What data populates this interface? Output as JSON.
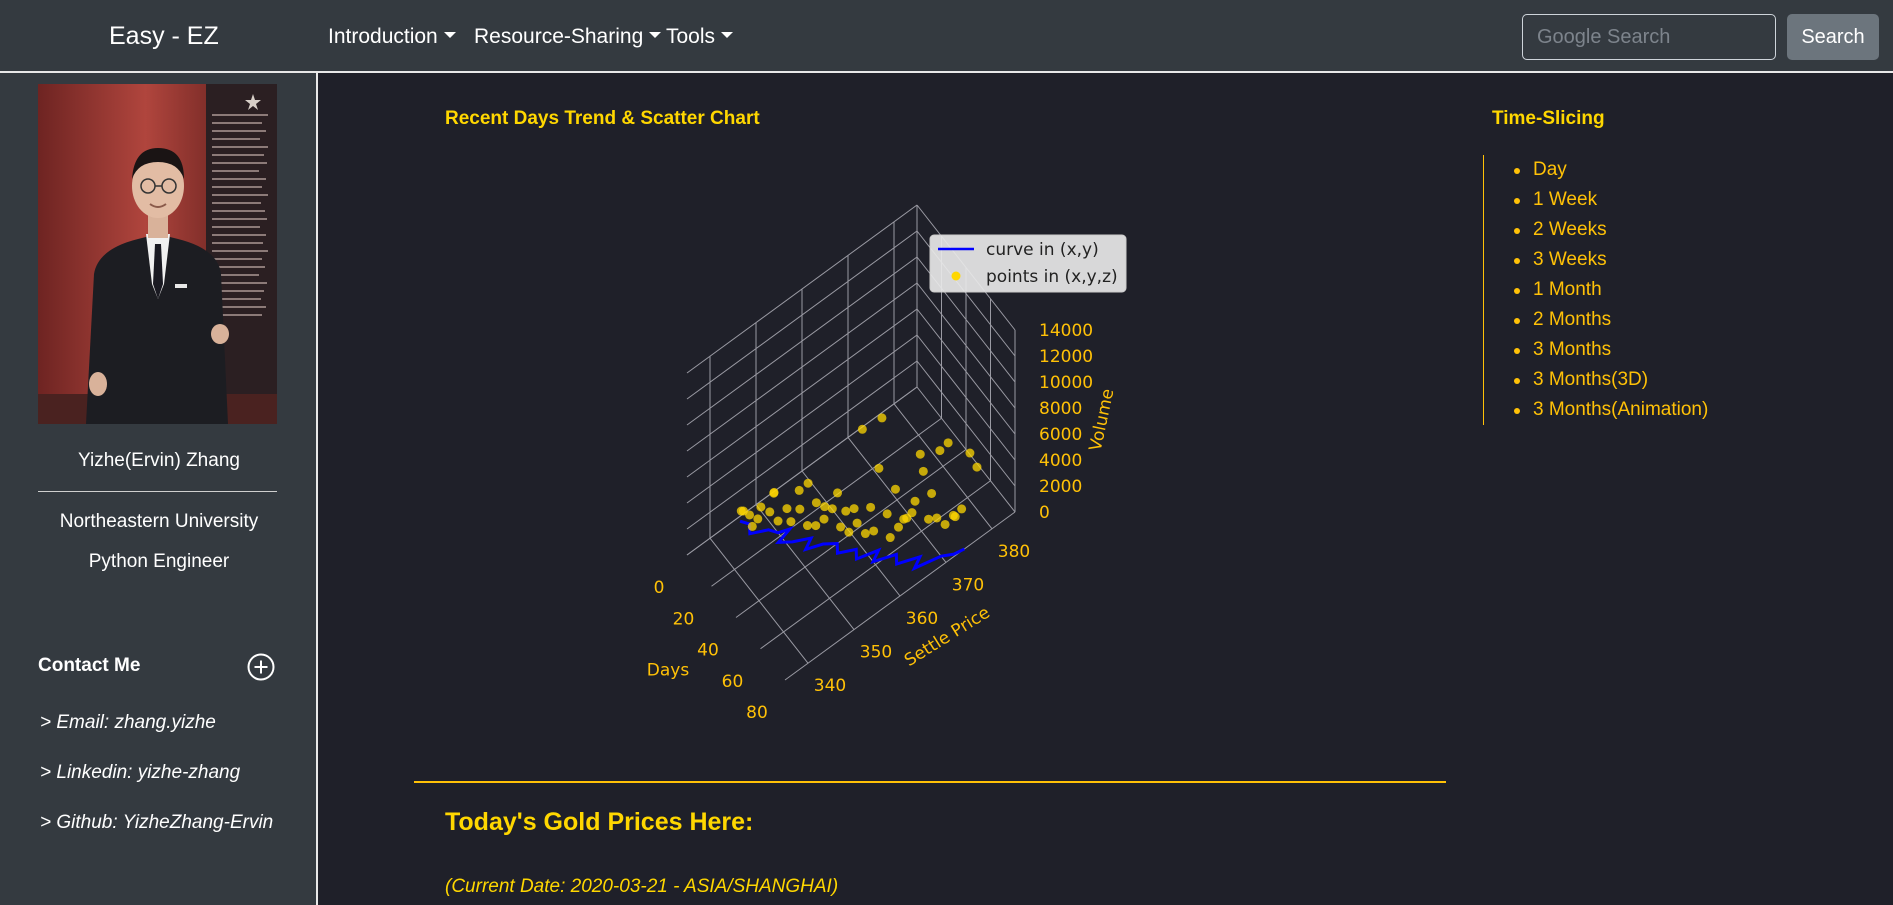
{
  "navbar": {
    "brand": "Easy - EZ",
    "menus": [
      "Introduction",
      "Resource-Sharing",
      "Tools"
    ],
    "search_placeholder": "Google Search",
    "search_button": "Search"
  },
  "sidebar": {
    "name": "Yizhe(Ervin) Zhang",
    "university": "Northeastern University",
    "role": "Python Engineer",
    "contact_title": "Contact Me",
    "contacts": [
      "> Email: zhang.yizhe",
      "> Linkedin: yizhe-zhang",
      "> Github: YizheZhang-Ervin"
    ]
  },
  "main": {
    "chart_title": "Recent Days Trend & Scatter Chart",
    "gold_title": "Today's Gold Prices Here:",
    "gold_date": "(Current Date: 2020-03-21 - ASIA/SHANGHAI)"
  },
  "time_slicing": {
    "title": "Time-Slicing",
    "items": [
      "Day",
      "1 Week",
      "2 Weeks",
      "3 Weeks",
      "1 Month",
      "2 Months",
      "3 Months",
      "3 Months(3D)",
      "3 Months(Animation)"
    ]
  },
  "colors": {
    "accent": "#ffc107",
    "gold_text": "#ffd700",
    "navbar": "#343a40",
    "background": "#1f2029",
    "curve": "#0000ff"
  },
  "chart_data": {
    "type": "scatter",
    "projection": "3d",
    "x_label": "Days",
    "y_label": "Settle Price",
    "z_label": "Volume",
    "x_ticks": [
      0,
      20,
      40,
      60,
      80
    ],
    "y_ticks": [
      340,
      350,
      360,
      370,
      380
    ],
    "z_ticks": [
      0,
      2000,
      4000,
      6000,
      8000,
      10000,
      12000,
      14000
    ],
    "xlim": [
      0,
      80
    ],
    "ylim": [
      335,
      385
    ],
    "zlim": [
      0,
      14000
    ],
    "legend": [
      "curve in (x,y)",
      "points in (x,y,z)"
    ],
    "legend_position": "top-right",
    "series": [
      {
        "name": "curve in (x,y)",
        "kind": "line",
        "color": "#0000ff",
        "points": [
          [
            2,
            346
          ],
          [
            6,
            347
          ],
          [
            10,
            346
          ],
          [
            14,
            349
          ],
          [
            18,
            350
          ],
          [
            20,
            352
          ],
          [
            22,
            349
          ],
          [
            26,
            351
          ],
          [
            30,
            354
          ],
          [
            33,
            352
          ],
          [
            36,
            355
          ],
          [
            40,
            357
          ],
          [
            44,
            356
          ],
          [
            48,
            359
          ],
          [
            52,
            358
          ],
          [
            55,
            362
          ],
          [
            58,
            360
          ],
          [
            62,
            364
          ],
          [
            66,
            363
          ],
          [
            70,
            367
          ],
          [
            73,
            365
          ],
          [
            76,
            370
          ],
          [
            79,
            372
          ],
          [
            80,
            374
          ]
        ]
      },
      {
        "name": "points in (x,y,z)",
        "kind": "scatter",
        "color": "#ffd700",
        "points": [
          [
            1,
            347,
            400
          ],
          [
            3,
            346,
            900
          ],
          [
            4,
            350,
            300
          ],
          [
            6,
            347,
            700
          ],
          [
            7,
            352,
            1200
          ],
          [
            9,
            348,
            500
          ],
          [
            11,
            351,
            2000
          ],
          [
            12,
            346,
            800
          ],
          [
            14,
            353,
            600
          ],
          [
            15,
            349,
            1500
          ],
          [
            17,
            355,
            400
          ],
          [
            18,
            350,
            900
          ],
          [
            20,
            356,
            2500
          ],
          [
            21,
            352,
            700
          ],
          [
            23,
            357,
            1100
          ],
          [
            24,
            353,
            3200
          ],
          [
            26,
            358,
            900
          ],
          [
            27,
            354,
            600
          ],
          [
            29,
            360,
            1800
          ],
          [
            30,
            355,
            700
          ],
          [
            32,
            361,
            500
          ],
          [
            33,
            356,
            1300
          ],
          [
            35,
            362,
            800
          ],
          [
            36,
            357,
            2200
          ],
          [
            38,
            363,
            7000
          ],
          [
            39,
            358,
            900
          ],
          [
            41,
            364,
            1100
          ],
          [
            42,
            359,
            600
          ],
          [
            44,
            365,
            4200
          ],
          [
            45,
            360,
            1400
          ],
          [
            47,
            366,
            800
          ],
          [
            48,
            361,
            700
          ],
          [
            50,
            367,
            2800
          ],
          [
            51,
            362,
            1000
          ],
          [
            53,
            368,
            600
          ],
          [
            54,
            363,
            9800
          ],
          [
            56,
            369,
            1200
          ],
          [
            57,
            364,
            700
          ],
          [
            59,
            370,
            5800
          ],
          [
            60,
            365,
            1600
          ],
          [
            62,
            371,
            900
          ],
          [
            63,
            366,
            2400
          ],
          [
            65,
            372,
            1100
          ],
          [
            66,
            367,
            3800
          ],
          [
            68,
            373,
            700
          ],
          [
            69,
            368,
            6200
          ],
          [
            71,
            374,
            1500
          ],
          [
            72,
            369,
            4600
          ],
          [
            74,
            375,
            2100
          ],
          [
            75,
            370,
            8000
          ],
          [
            77,
            376,
            6500
          ],
          [
            78,
            371,
            8700
          ],
          [
            79,
            377,
            5400
          ],
          [
            80,
            372,
            3000
          ]
        ]
      }
    ]
  }
}
